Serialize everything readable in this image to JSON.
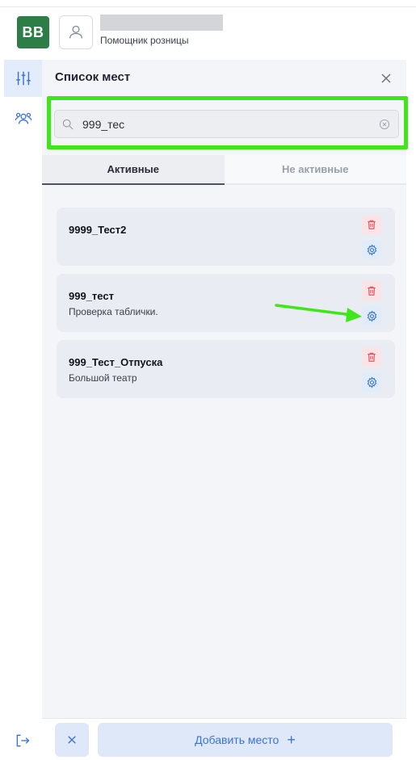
{
  "header": {
    "logo_text": "BB",
    "role": "Помощник розницы"
  },
  "panel": {
    "title": "Список мест",
    "search": {
      "value": "999_тес",
      "placeholder": ""
    },
    "tabs": [
      {
        "label": "Активные",
        "active": true
      },
      {
        "label": "Не активные",
        "active": false
      }
    ],
    "items": [
      {
        "title": "9999_Тест2",
        "subtitle": ""
      },
      {
        "title": "999_тест",
        "subtitle": "Проверка таблички."
      },
      {
        "title": "999_Тест_Отпуска",
        "subtitle": "Большой театр"
      }
    ]
  },
  "footer": {
    "add_label": "Добавить место",
    "add_plus": "+"
  },
  "colors": {
    "brand": "#2d7d46",
    "accent": "#3a73d6",
    "highlight": "#3ee61a",
    "danger": "#e05561"
  },
  "icons": {
    "rail": [
      "filters-icon",
      "users-icon",
      "logout-icon"
    ],
    "card_actions": [
      "trash-icon",
      "gear-icon"
    ]
  }
}
